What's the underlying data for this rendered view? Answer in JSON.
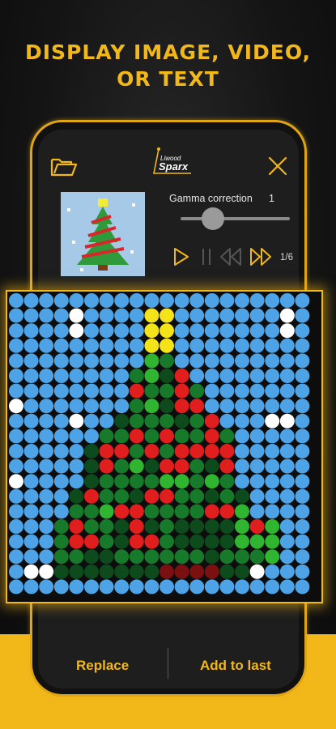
{
  "headline": {
    "line1": "DISPLAY IMAGE, VIDEO,",
    "line2": "OR TEXT"
  },
  "app": {
    "logo_small": "Liwood",
    "logo_main": "Sparx",
    "open_icon": "folder-open-icon",
    "close_icon": "close-icon"
  },
  "controls": {
    "gamma_label": "Gamma correction",
    "gamma_value": "1",
    "gamma_level": 0.25,
    "page_counter": "1/6",
    "play_icon": "play-icon",
    "pause_icon": "pause-icon",
    "prev_icon": "rewind-icon",
    "next_icon": "fast-forward-icon"
  },
  "actions": {
    "replace_label": "Replace",
    "add_label": "Add to last"
  },
  "colors": {
    "accent": "#f2b81a",
    "led_background": "#4da3e6",
    "led_white": "#ffffff",
    "led_yellow": "#f5e31a",
    "led_light_green": "#2fb52f",
    "led_green": "#177a2a",
    "led_dark_green": "#0d4a1c",
    "led_red": "#e01e1e",
    "led_dark_red": "#7a1010"
  },
  "led_matrix": {
    "columns": 20,
    "rows": 20,
    "legend": {
      "b": "led_background",
      "w": "led_white",
      "y": "led_yellow",
      "l": "led_light_green",
      "g": "led_green",
      "d": "led_dark_green",
      "r": "led_red",
      "x": "led_dark_red"
    },
    "pixels": [
      "bbbbbbbbbbbbbbbbbbbb",
      "bbbbwbbbbyybbbbbbbwb",
      "bbbbwbbbbyybbbbbbbwb",
      "bbbbbbbbbyybbbbbbbbb",
      "bbbbbbbbblgbbbbbbbbb",
      "bbbbbbbbgldrbbbbbbbb",
      "bbbbbbbbrggrgbbbbbbb",
      "wbbbbbbbgldrrbbbbbbb",
      "bbbbwbbdgggdgrbbbwwb",
      "bbbbbbggrgrggrgbbbbb",
      "bbbbbdrrgrgrrrrbbbbb",
      "bbbbbdrgldrrgdrbbbbb",
      "wbbbbdggggllglgbbbbb",
      "bbbbdrggdrrggdgdbbbb",
      "bbbbgglrrggggrrlbbbb",
      "bbbgrggdrdgddddlrlbb",
      "bbbgrrgdrrgddddlllbb",
      "bbbggddggggggdggglbb",
      "bwwdddddddxxxxddwbbb",
      "bbbbbbbbbbbbbbbbbbbb"
    ]
  }
}
